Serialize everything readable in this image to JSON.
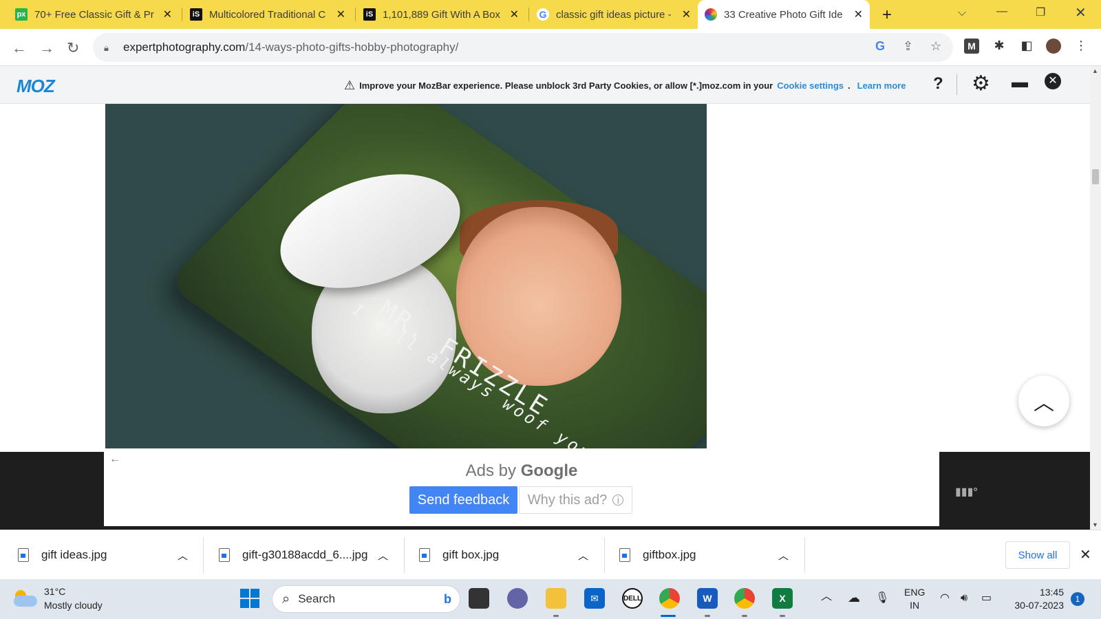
{
  "browser": {
    "tabs": [
      {
        "title": "70+ Free Classic Gift & Pr",
        "favicon": "px-icon",
        "active": false
      },
      {
        "title": "Multicolored Traditional C",
        "favicon": "istock-icon",
        "active": false
      },
      {
        "title": "1,101,889 Gift With A Box",
        "favicon": "istock-icon",
        "active": false
      },
      {
        "title": "classic gift ideas picture -",
        "favicon": "google-icon",
        "active": false
      },
      {
        "title": "33 Creative Photo Gift Ide",
        "favicon": "photo-site-icon",
        "active": true
      }
    ],
    "new_tab_label": "+",
    "url_host": "expertphotography.com",
    "url_path": "/14-ways-photo-gifts-hobby-photography/"
  },
  "mozbar": {
    "logo": "MOZ",
    "notice": "Improve your MozBar experience. Please unblock 3rd Party Cookies, or allow [*.]moz.com in your",
    "cookie_link": "Cookie settings",
    "learn_more": "Learn more",
    "help_label": "?"
  },
  "photo": {
    "line1": "MR. FRIZZLE",
    "line2": "I will always woof you"
  },
  "ad": {
    "ads_by": "Ads by",
    "google": "Google",
    "send_feedback": "Send feedback",
    "why_this_ad": "Why this ad?"
  },
  "downloads": {
    "items": [
      {
        "name": "gift ideas.jpg"
      },
      {
        "name": "gift-g30188acdd_6....jpg"
      },
      {
        "name": "gift box.jpg"
      },
      {
        "name": "giftbox.jpg"
      }
    ],
    "show_all": "Show all"
  },
  "taskbar": {
    "temperature": "31°C",
    "weather": "Mostly cloudy",
    "search_placeholder": "Search",
    "lang_top": "ENG",
    "lang_bottom": "IN",
    "time": "13:45",
    "date": "30-07-2023",
    "notification_count": "1"
  },
  "colors": {
    "tabstrip": "#f7d94c",
    "moz_blue": "#1a86d6",
    "feedback_blue": "#4285f4"
  }
}
